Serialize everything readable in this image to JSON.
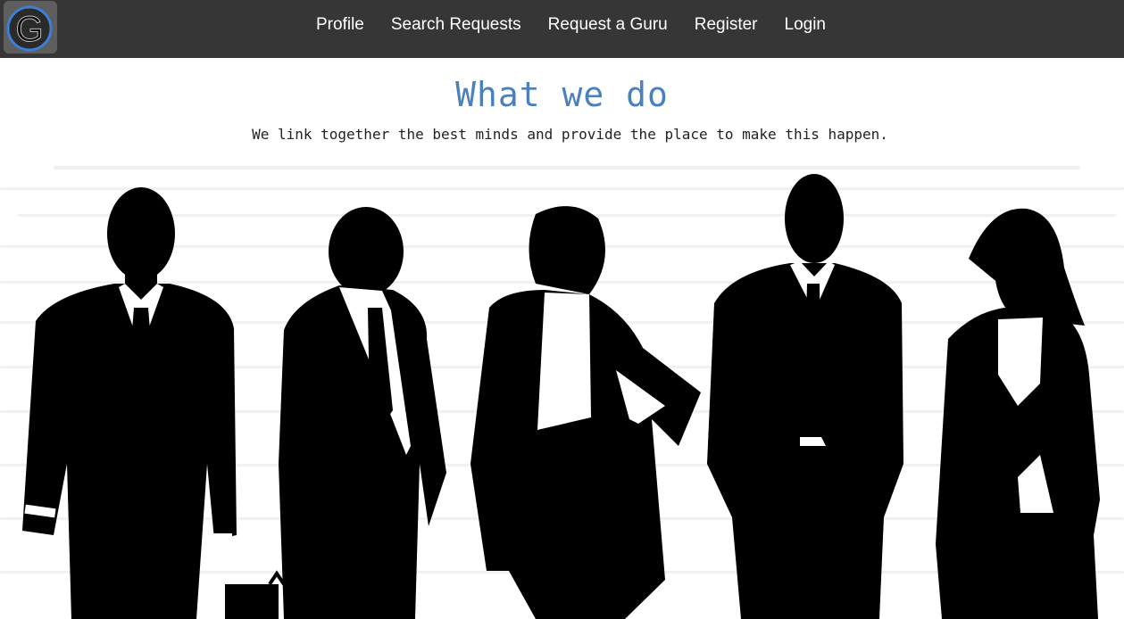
{
  "navbar": {
    "logo_letter": "G",
    "links": [
      {
        "label": "Profile"
      },
      {
        "label": "Search Requests"
      },
      {
        "label": "Request a Guru"
      },
      {
        "label": "Register"
      },
      {
        "label": "Login"
      }
    ]
  },
  "hero": {
    "title": "What we do",
    "subtitle": "We link together the best minds and provide the place to make this happen."
  },
  "colors": {
    "navbar_bg": "#363636",
    "accent": "#4b80bd",
    "logo_ring": "#3d7fd6"
  }
}
